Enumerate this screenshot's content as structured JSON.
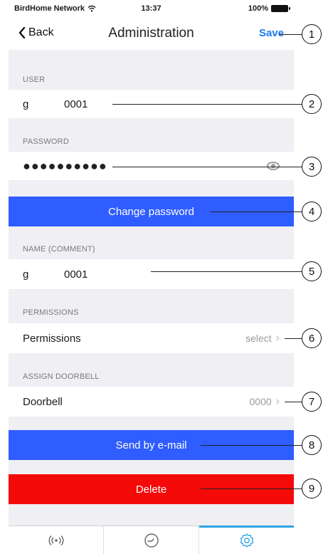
{
  "status_bar": {
    "carrier": "BirdHome Network",
    "time": "13:37",
    "battery": "100%"
  },
  "nav": {
    "back_label": "Back",
    "title": "Administration",
    "save_label": "Save"
  },
  "user": {
    "section": "USER",
    "prefix": "g",
    "value": "0001"
  },
  "password": {
    "section": "PASSWORD",
    "masked": "●●●●●●●●●●"
  },
  "change_password": {
    "label": "Change password"
  },
  "name": {
    "section": "NAME (COMMENT)",
    "prefix": "g",
    "value": "0001"
  },
  "permissions": {
    "section": "PERMISSIONS",
    "label": "Permissions",
    "value": "select"
  },
  "doorbell": {
    "section": "ASSIGN DOORBELL",
    "label": "Doorbell",
    "value": "0000"
  },
  "send_email": {
    "label": "Send by e-mail"
  },
  "delete": {
    "label": "Delete"
  },
  "tabs": [
    {
      "icon": "broadcast-icon"
    },
    {
      "icon": "clock-icon"
    },
    {
      "icon": "gear-icon",
      "active": true
    }
  ],
  "callouts": [
    "1",
    "2",
    "3",
    "4",
    "5",
    "6",
    "7",
    "8",
    "9"
  ],
  "colors": {
    "accent_blue": "#2f5dff",
    "danger_red": "#f50a0a",
    "link_blue": "#1d7cf2",
    "tab_active": "#2aa3e6"
  }
}
